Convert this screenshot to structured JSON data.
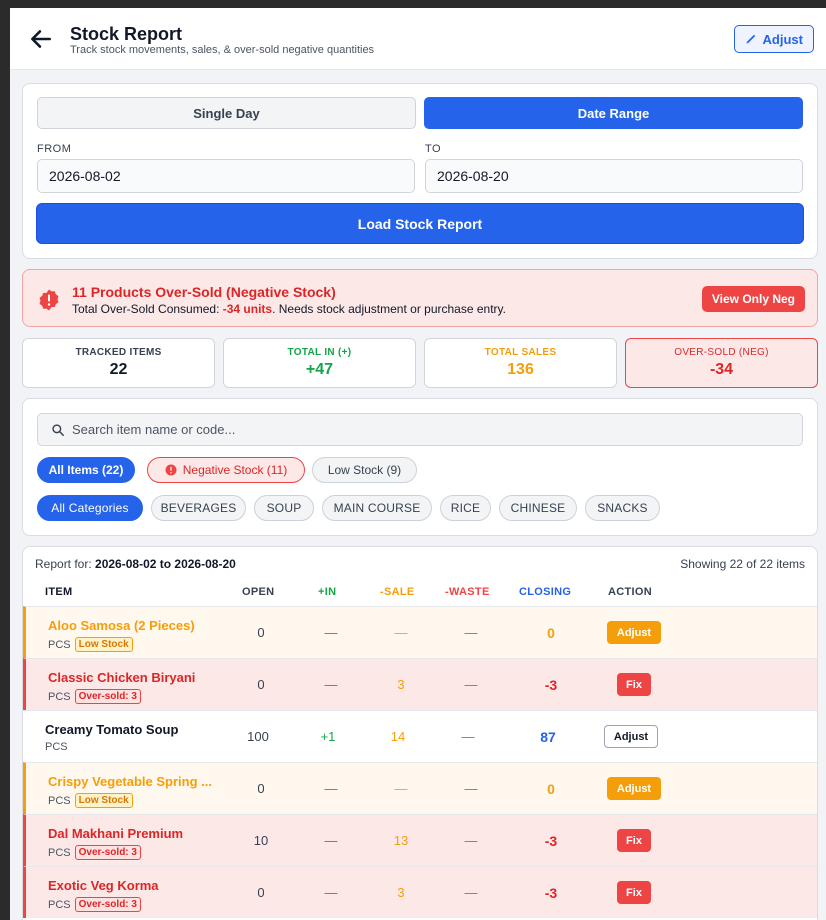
{
  "header": {
    "title": "Stock Report",
    "subtitle": "Track stock movements, sales, & over-sold negative quantities",
    "adjust_label": "Adjust"
  },
  "mode": {
    "single_day": "Single Day",
    "date_range": "Date Range",
    "selected": "date_range"
  },
  "dates": {
    "from_label": "FROM",
    "from_value": "2026-08-02",
    "to_label": "TO",
    "to_value": "2026-08-20"
  },
  "load_label": "Load Stock Report",
  "alert": {
    "title": "11 Products Over-Sold (Negative Stock)",
    "desc_prefix": "Total Over-Sold Consumed: ",
    "desc_units": "-34 units",
    "desc_suffix": ". Needs stock adjustment or purchase entry.",
    "button": "View Only Neg"
  },
  "stats": [
    {
      "label": "TRACKED ITEMS",
      "value": "22",
      "color": "#111827"
    },
    {
      "label": "TOTAL IN (+)",
      "value": "+47",
      "color": "#16a34a"
    },
    {
      "label": "TOTAL SALES",
      "value": "136",
      "color": "#f59e0b"
    },
    {
      "label": "OVER-SOLD (NEG)",
      "value": "-34",
      "color": "#dc2626"
    }
  ],
  "filters": {
    "search_placeholder": "Search item name or code...",
    "stock_chips": [
      "All Items (22)",
      "Negative Stock (11)",
      "Low Stock (9)"
    ],
    "category_chips": [
      "All Categories",
      "BEVERAGES",
      "SOUP",
      "MAIN COURSE",
      "RICE",
      "CHINESE",
      "SNACKS"
    ]
  },
  "table": {
    "report_for_label": "Report for: ",
    "report_for_value": "2026-08-02 to 2026-08-20",
    "showing": "Showing 22 of 22 items",
    "columns": [
      "ITEM",
      "OPEN",
      "+IN",
      "-SALE",
      "-WASTE",
      "CLOSING",
      "ACTION"
    ],
    "rows": [
      {
        "name": "Aloo Samosa (2 Pieces)",
        "unit": "PCS",
        "badge": "Low Stock",
        "open": "0",
        "in": "—",
        "sale": "—",
        "waste": "—",
        "closing": "0",
        "action": "Adjust",
        "status": "low"
      },
      {
        "name": "Classic Chicken Biryani",
        "unit": "PCS",
        "badge": "Over-sold: 3",
        "open": "0",
        "in": "—",
        "sale": "3",
        "waste": "—",
        "closing": "-3",
        "action": "Fix",
        "status": "neg"
      },
      {
        "name": "Creamy Tomato Soup",
        "unit": "PCS",
        "badge": "",
        "open": "100",
        "in": "+1",
        "sale": "14",
        "waste": "—",
        "closing": "87",
        "action": "Adjust",
        "status": "norm"
      },
      {
        "name": "Crispy Vegetable Spring ...",
        "unit": "PCS",
        "badge": "Low Stock",
        "open": "0",
        "in": "—",
        "sale": "—",
        "waste": "—",
        "closing": "0",
        "action": "Adjust",
        "status": "low"
      },
      {
        "name": "Dal Makhani Premium",
        "unit": "PCS",
        "badge": "Over-sold: 3",
        "open": "10",
        "in": "—",
        "sale": "13",
        "waste": "—",
        "closing": "-3",
        "action": "Fix",
        "status": "neg"
      },
      {
        "name": "Exotic Veg Korma",
        "unit": "PCS",
        "badge": "Over-sold: 3",
        "open": "0",
        "in": "—",
        "sale": "3",
        "waste": "—",
        "closing": "-3",
        "action": "Fix",
        "status": "neg"
      }
    ]
  },
  "colors": {
    "primary": "#2563eb",
    "danger": "#ef4444",
    "warning": "#f59e0b",
    "success": "#16a34a"
  }
}
